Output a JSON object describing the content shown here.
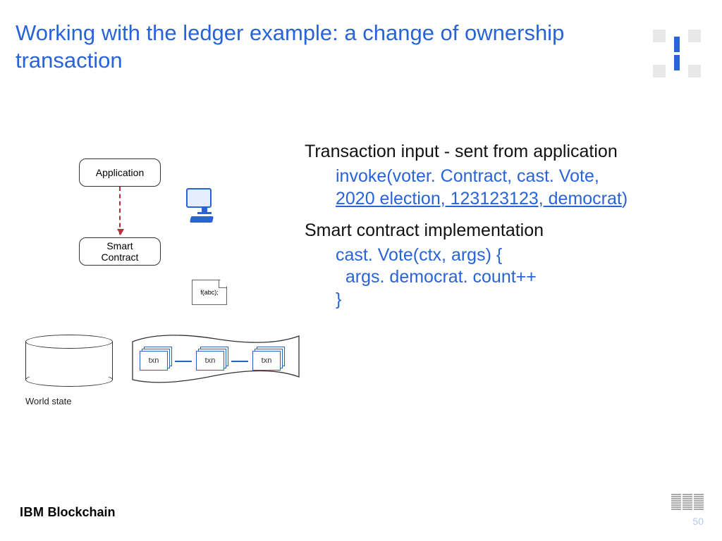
{
  "title": "Working with the ledger example: a change of ownership transaction",
  "diagram": {
    "application_label": "Application",
    "smart_contract_label": "Smart\nContract",
    "code_note": "f(abc);",
    "world_state_label": "World state",
    "txn_label": "txn"
  },
  "content": {
    "heading1": "Transaction input - sent from application",
    "invoke_prefix": "invoke(voter. Contract, cast. Vote, ",
    "invoke_args": "2020 election, 123123123, democrat",
    "invoke_suffix": ")",
    "heading2": "Smart contract implementation",
    "code_line1": "cast. Vote(ctx, args) {",
    "code_line2": "  args. democrat. count++",
    "code_line3": "}"
  },
  "footer": {
    "brand_left_ibm": "IBM",
    "brand_left_bc": " Blockchain",
    "page_number": "50"
  }
}
